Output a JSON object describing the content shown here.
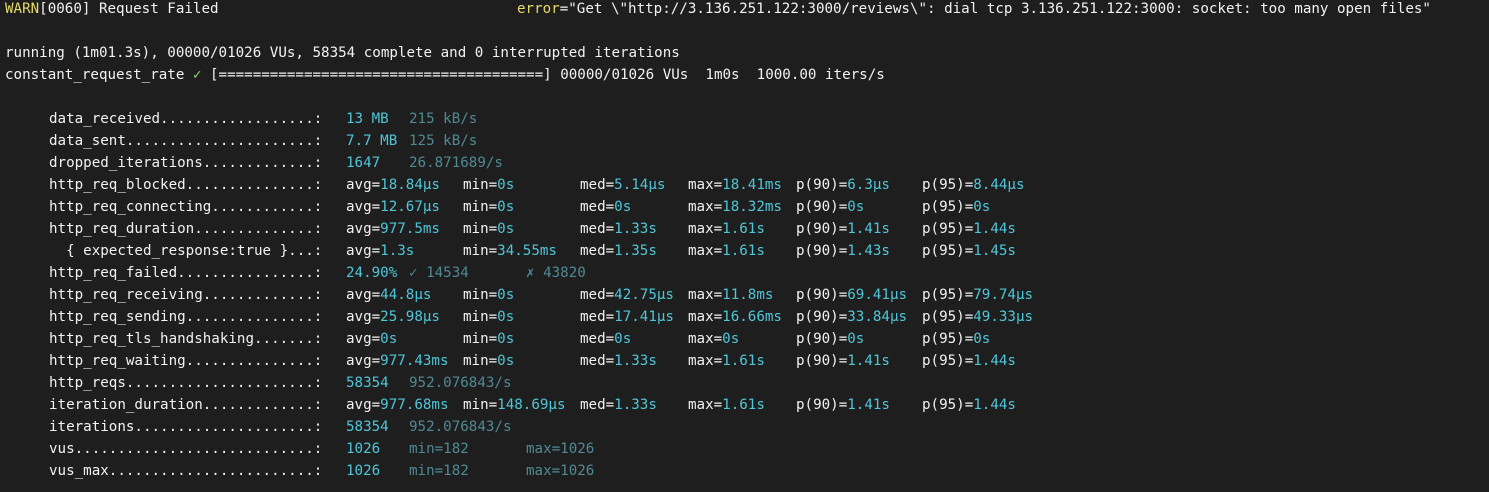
{
  "warn": {
    "level": "WARN",
    "code": "[0060]",
    "message": " Request Failed",
    "error_key": "error",
    "error_value": "=\"Get \\\"http://3.136.251.122:3000/reviews\\\": dial tcp 3.136.251.122:3000: socket: too many open files\""
  },
  "status": {
    "running": "running (1m01.3s), 00000/01026 VUs, 58354 complete and 0 interrupted iterations",
    "scenario_name": "constant_request_rate ",
    "check_mark": "✓",
    "progress": " [======================================] 00000/01026 VUs  1m0s  1000.00 iters/s"
  },
  "metrics": {
    "data_received": {
      "label": "data_received..................:",
      "value": "13 MB",
      "rate": "215 kB/s"
    },
    "data_sent": {
      "label": "data_sent......................:",
      "value": "7.7 MB",
      "rate": "125 kB/s"
    },
    "dropped_iterations": {
      "label": "dropped_iterations.............:",
      "value": "1647",
      "rate": "26.871689/s"
    },
    "http_req_blocked": {
      "label": "http_req_blocked...............:",
      "avg": "18.84µs",
      "min": "0s",
      "med": "5.14µs",
      "max": "18.41ms",
      "p90": "6.3µs",
      "p95": "8.44µs"
    },
    "http_req_connecting": {
      "label": "http_req_connecting............:",
      "avg": "12.67µs",
      "min": "0s",
      "med": "0s",
      "max": "18.32ms",
      "p90": "0s",
      "p95": "0s"
    },
    "http_req_duration": {
      "label": "http_req_duration..............:",
      "avg": "977.5ms",
      "min": "0s",
      "med": "1.33s",
      "max": "1.61s",
      "p90": "1.41s",
      "p95": "1.44s"
    },
    "expected_response": {
      "label": "  { expected_response:true }...:",
      "avg": "1.3s",
      "min": "34.55ms",
      "med": "1.35s",
      "max": "1.61s",
      "p90": "1.43s",
      "p95": "1.45s"
    },
    "http_req_failed": {
      "label": "http_req_failed................:",
      "value": "24.90%",
      "pass": "✓ 14534",
      "fail": "✗ 43820"
    },
    "http_req_receiving": {
      "label": "http_req_receiving.............:",
      "avg": "44.8µs",
      "min": "0s",
      "med": "42.75µs",
      "max": "11.8ms",
      "p90": "69.41µs",
      "p95": "79.74µs"
    },
    "http_req_sending": {
      "label": "http_req_sending...............:",
      "avg": "25.98µs",
      "min": "0s",
      "med": "17.41µs",
      "max": "16.66ms",
      "p90": "33.84µs",
      "p95": "49.33µs"
    },
    "http_req_tls_handshaking": {
      "label": "http_req_tls_handshaking.......:",
      "avg": "0s",
      "min": "0s",
      "med": "0s",
      "max": "0s",
      "p90": "0s",
      "p95": "0s"
    },
    "http_req_waiting": {
      "label": "http_req_waiting...............:",
      "avg": "977.43ms",
      "min": "0s",
      "med": "1.33s",
      "max": "1.61s",
      "p90": "1.41s",
      "p95": "1.44s"
    },
    "http_reqs": {
      "label": "http_reqs......................:",
      "value": "58354",
      "rate": "952.076843/s"
    },
    "iteration_duration": {
      "label": "iteration_duration.............:",
      "avg": "977.68ms",
      "min": "148.69µs",
      "med": "1.33s",
      "max": "1.61s",
      "p90": "1.41s",
      "p95": "1.44s"
    },
    "iterations": {
      "label": "iterations.....................:",
      "value": "58354",
      "rate": "952.076843/s"
    },
    "vus": {
      "label": "vus............................:",
      "value": "1026",
      "min": "min=182",
      "max": "max=1026"
    },
    "vus_max": {
      "label": "vus_max........................:",
      "value": "1026",
      "min": "min=182",
      "max": "max=1026"
    }
  },
  "stat_keys": {
    "avg": "avg=",
    "min": "min=",
    "med": "med=",
    "max": "max=",
    "p90": "p(90)=",
    "p95": "p(95)="
  },
  "colors": {
    "background": "#1e1e1e",
    "text": "#f2f2f2",
    "warn": "#e6d96a",
    "value": "#4fc6d8",
    "dim": "#4f8994",
    "check": "#8fd16b"
  }
}
